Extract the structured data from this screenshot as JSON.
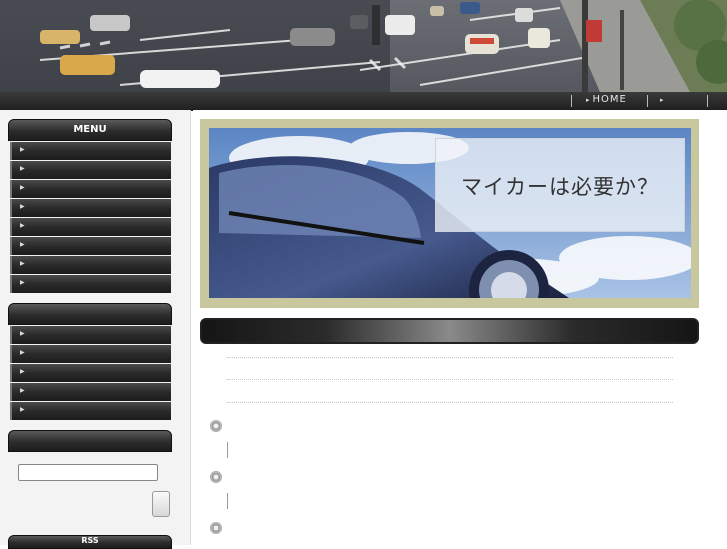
{
  "nav": {
    "home_label": "HOME"
  },
  "sidebar": {
    "menu_title": "MENU",
    "menu_items": [
      "",
      "",
      "",
      "",
      "",
      "",
      "",
      ""
    ],
    "second_items": [
      "",
      "",
      "",
      "",
      ""
    ],
    "search": {
      "value": "",
      "placeholder": ""
    },
    "rss_title": "RSS"
  },
  "main": {
    "hero_caption": "マイカーは必要か？",
    "title_bar_text": ""
  },
  "colors": {
    "hero_frame": "#c9c79d",
    "nav_bar": "#202020",
    "side_header": "#2c2c2c"
  },
  "icons": [
    "bullet-arrow-icon",
    "post-bullet-icon"
  ]
}
